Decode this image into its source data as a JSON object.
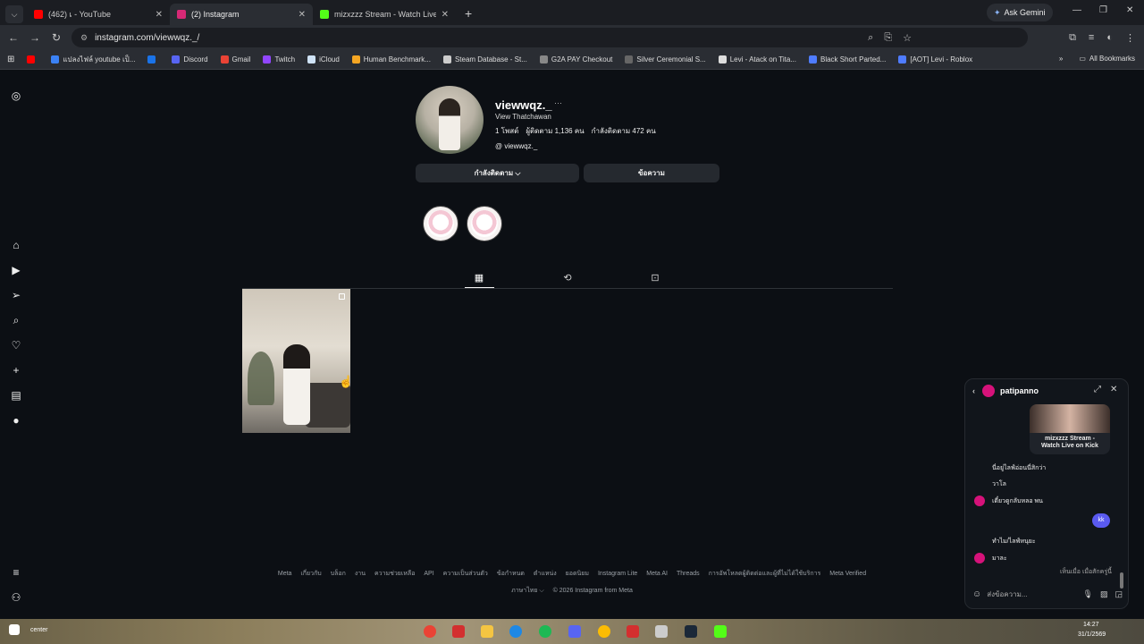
{
  "browser": {
    "tabs": [
      {
        "label": "(462) เ - YouTube",
        "color": "#ff0000"
      },
      {
        "label": "(2) Instagram",
        "color": "#d62976"
      },
      {
        "label": "mizxzzz Stream - Watch Live on",
        "color": "#53fc18"
      }
    ],
    "ask_gemini": "Ask Gemini",
    "url": "instagram.com/viewwqz._/",
    "bookmarks": [
      {
        "label": "",
        "color": "#ff0000"
      },
      {
        "label": "แปลงไฟล์ youtube เป็...",
        "color": "#3b82f6"
      },
      {
        "label": "",
        "color": "#1a73e8"
      },
      {
        "label": "Discord",
        "color": "#5865f2"
      },
      {
        "label": "Gmail",
        "color": "#ea4335"
      },
      {
        "label": "Twitch",
        "color": "#9146ff"
      },
      {
        "label": "iCloud",
        "color": "#cfe3f7"
      },
      {
        "label": "Human Benchmark...",
        "color": "#f5a623"
      },
      {
        "label": "Steam Database - St...",
        "color": "#cccccc"
      },
      {
        "label": "G2A PAY Checkout",
        "color": "#888888"
      },
      {
        "label": "Silver Ceremonial S...",
        "color": "#666666"
      },
      {
        "label": "Levi - Atack on Tita...",
        "color": "#dddddd"
      },
      {
        "label": "Black Short Parted...",
        "color": "#4f7cff"
      },
      {
        "label": "[AOT] Levi - Roblox",
        "color": "#4f7cff"
      }
    ],
    "all_bookmarks": "All Bookmarks"
  },
  "profile": {
    "username": "viewwqz._",
    "full_name": "View Thatchawan",
    "posts": "1 โพสต์",
    "followers": "ผู้ติดตาม 1,136 คน",
    "following": "กำลังติดตาม 472 คน",
    "threads": "viewwqz._",
    "following_button": "กำลังติดตาม ⌵",
    "message_button": "ข้อความ"
  },
  "footer": {
    "links": [
      "Meta",
      "เกี่ยวกับ",
      "บล็อก",
      "งาน",
      "ความช่วยเหลือ",
      "API",
      "ความเป็นส่วนตัว",
      "ข้อกำหนด",
      "ตำแหน่ง",
      "ยอดนิยม",
      "Instagram Lite",
      "Meta AI",
      "Threads",
      "การอัพโหลดผู้ติดต่อและผู้ที่ไม่ได้ใช้บริการ",
      "Meta Verified"
    ],
    "language": "ภาษาไทย ⌵",
    "copyright": "© 2026 Instagram from Meta"
  },
  "chat": {
    "name": "patipanno",
    "shared_title": "mizxzzz Stream - Watch Live on Kick",
    "messages": [
      {
        "text": "นี่อยู่ไลฟ์อ่อนนี่สิกว่า"
      },
      {
        "text": "วาโล"
      },
      {
        "text": "เดี๋ยวดูกลับหลอ พน"
      },
      {
        "text": "kk"
      },
      {
        "text": "ทำไม/ไลฟ์หนุยะ"
      },
      {
        "text": "มาละ"
      }
    ],
    "seen": "เห็นเมื่อ เมื่อสักครู่นี้",
    "placeholder": "ส่งข้อความ..."
  },
  "taskbar": {
    "left_text": "center",
    "time": "14:27",
    "date": "31/1/2569"
  }
}
